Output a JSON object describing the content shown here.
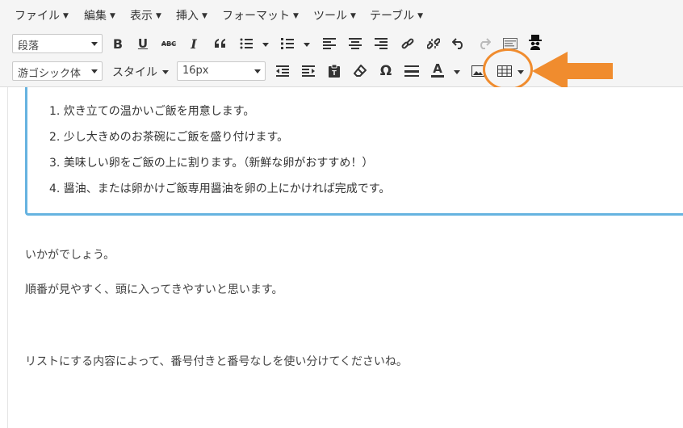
{
  "menubar": {
    "items": [
      "ファイル",
      "編集",
      "表示",
      "挿入",
      "フォーマット",
      "ツール",
      "テーブル"
    ]
  },
  "toolbar": {
    "format_select": "段落",
    "font_select": "游ゴシック体",
    "style_dropdown": "スタイル",
    "size_select": "16px",
    "icons_row1": [
      "bold-icon",
      "underline-icon",
      "strikethrough-icon",
      "italic-icon",
      "blockquote-icon",
      "bullet-list-icon",
      "numbered-list-icon",
      "align-left-icon",
      "align-center-icon",
      "align-right-icon",
      "link-icon",
      "unlink-icon",
      "undo-icon",
      "redo-icon",
      "preview-icon",
      "spy-icon"
    ],
    "icons_row2": [
      "outdent-icon",
      "indent-icon",
      "paste-text-icon",
      "eraser-icon",
      "omega-icon",
      "horizontal-rule-icon",
      "text-color-icon",
      "image-icon",
      "table-icon"
    ],
    "labels": {
      "bold": "B",
      "underline": "U",
      "strike": "ABC",
      "italic": "I",
      "omega": "Ω",
      "text_color": "A"
    }
  },
  "annotation": {
    "highlight_color": "#f08c2e",
    "target": "table-icon"
  },
  "content": {
    "list": [
      "1. 炊き立ての温かいご飯を用意します。",
      "2. 少し大きめのお茶碗にご飯を盛り付けます。",
      "3. 美味しい卵をご飯の上に割ります。（新鮮な卵がおすすめ！）",
      "4. 醤油、または卵かけご飯専用醤油を卵の上にかければ完成です。"
    ],
    "paragraphs": [
      "いかがでしょう。",
      "順番が見やすく、頭に入ってきやすいと思います。",
      "リストにする内容によって、番号付きと番号なしを使い分けてくださいね。"
    ],
    "list_border_color": "#66b3e0"
  }
}
